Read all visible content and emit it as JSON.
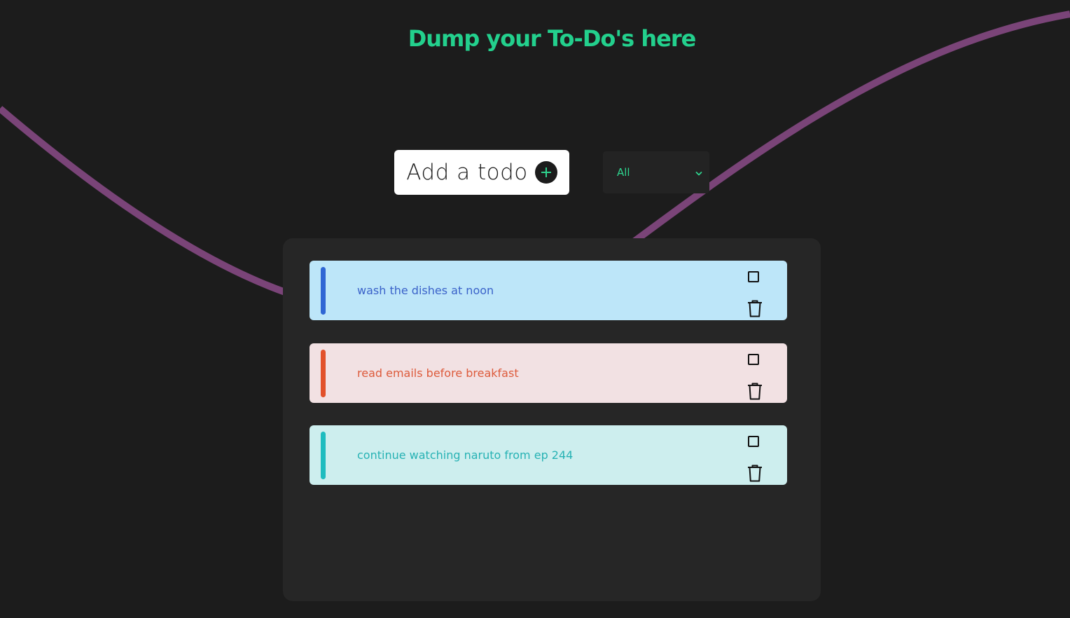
{
  "page": {
    "title": "Dump your To-Do's here"
  },
  "add_todo": {
    "label": "Add a todo",
    "icon": "plus-icon"
  },
  "filter": {
    "selected": "All",
    "icon": "chevron-down-icon"
  },
  "todos": [
    {
      "text": "wash the dishes at noon",
      "checked": false,
      "card_color": "#bde6f9",
      "accent_color": "#2f66d4",
      "text_color": "#3a62c9"
    },
    {
      "text": "read emails before breakfast",
      "checked": false,
      "card_color": "#f2e1e3",
      "accent_color": "#e2512b",
      "text_color": "#dd5b3c"
    },
    {
      "text": "continue watching naruto from ep 244",
      "checked": false,
      "card_color": "#cdeeee",
      "accent_color": "#1fbcbf",
      "text_color": "#27b2b4"
    }
  ],
  "colors": {
    "background": "#1c1c1c",
    "panel": "#262626",
    "title": "#23d08d",
    "accent_green": "#2ed38e",
    "curve": "#7a4478"
  }
}
